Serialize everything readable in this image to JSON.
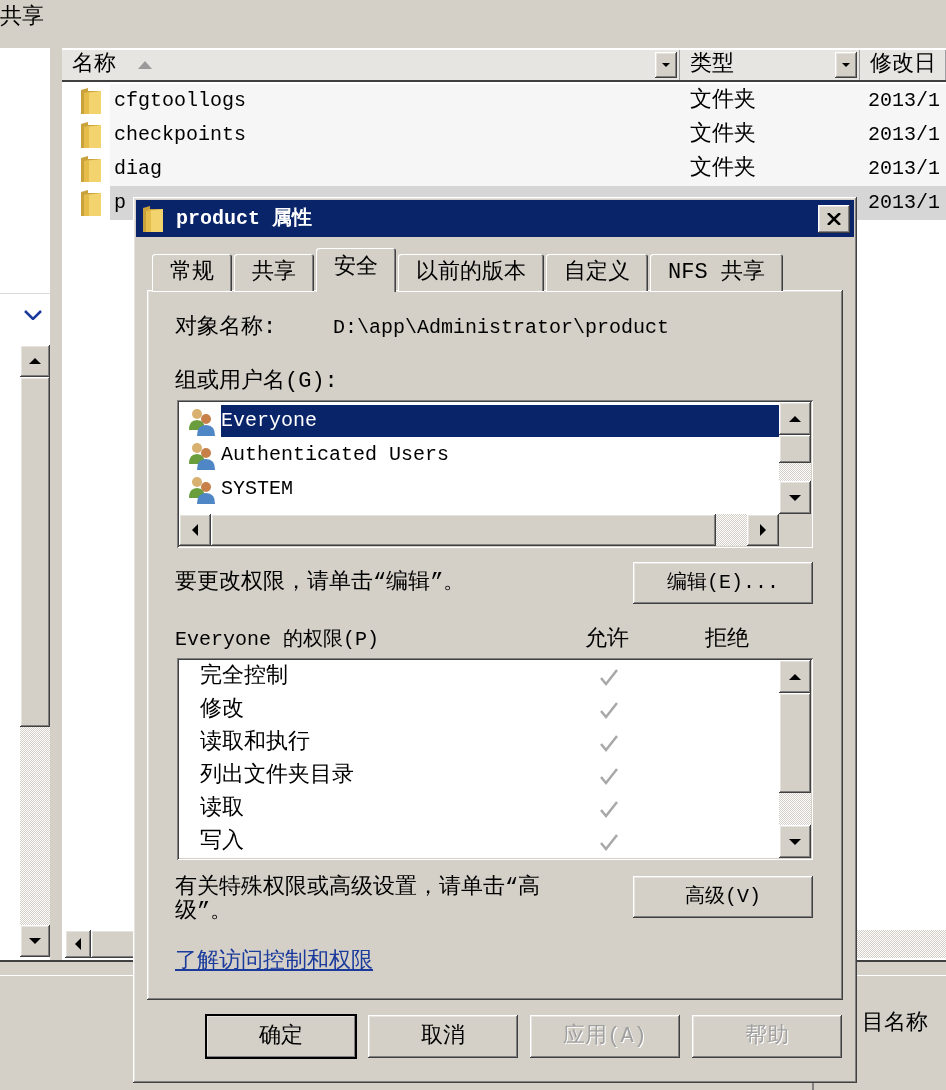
{
  "explorer": {
    "toolbar_text": "共享",
    "columns": [
      {
        "label": "名称",
        "sorted": true,
        "dropdown": true
      },
      {
        "label": "类型",
        "sorted": false,
        "dropdown": true
      },
      {
        "label": "修改日",
        "sorted": false,
        "dropdown": false
      }
    ],
    "rows": [
      {
        "name": "cfgtoollogs",
        "type": "文件夹",
        "date": "2013/1",
        "selected": false
      },
      {
        "name": "checkpoints",
        "type": "文件夹",
        "date": "2013/1",
        "selected": false
      },
      {
        "name": "diag",
        "type": "文件夹",
        "date": "2013/1",
        "selected": false
      },
      {
        "name": "p",
        "date": "2013/1",
        "selected": true
      }
    ],
    "status_text": "目名称"
  },
  "dialog": {
    "title": "product 属性",
    "tabs": [
      {
        "label": "常规",
        "selected": false
      },
      {
        "label": "共享",
        "selected": false
      },
      {
        "label": "安全",
        "selected": true
      },
      {
        "label": "以前的版本",
        "selected": false
      },
      {
        "label": "自定义",
        "selected": false
      },
      {
        "label": "NFS 共享",
        "selected": false
      }
    ],
    "object_name_label": "对象名称:",
    "object_name": "D:\\app\\Administrator\\product",
    "users_label": "组或用户名(G):",
    "users": [
      {
        "name": "Everyone",
        "selected": true
      },
      {
        "name": "Authenticated Users",
        "selected": false
      },
      {
        "name": "SYSTEM",
        "selected": false
      }
    ],
    "edit_hint": "要更改权限，请单击“编辑”。",
    "edit_button": "编辑(E)...",
    "permissions_label": "Everyone 的权限(P)",
    "allow_header": "允许",
    "deny_header": "拒绝",
    "permissions": [
      {
        "name": "完全控制",
        "allow": true,
        "deny": false
      },
      {
        "name": "修改",
        "allow": true,
        "deny": false
      },
      {
        "name": "读取和执行",
        "allow": true,
        "deny": false
      },
      {
        "name": "列出文件夹目录",
        "allow": true,
        "deny": false
      },
      {
        "name": "读取",
        "allow": true,
        "deny": false
      },
      {
        "name": "写入",
        "allow": true,
        "deny": false
      }
    ],
    "advanced_hint": "有关特殊权限或高级设置，请单击“高级”。",
    "advanced_button": "高级(V)",
    "link": "了解访问控制和权限",
    "buttons": [
      {
        "label": "确定",
        "default": true,
        "disabled": false
      },
      {
        "label": "取消",
        "default": false,
        "disabled": false
      },
      {
        "label": "应用(A)",
        "default": false,
        "disabled": true
      },
      {
        "label": "帮助",
        "default": false,
        "disabled": true
      }
    ]
  }
}
